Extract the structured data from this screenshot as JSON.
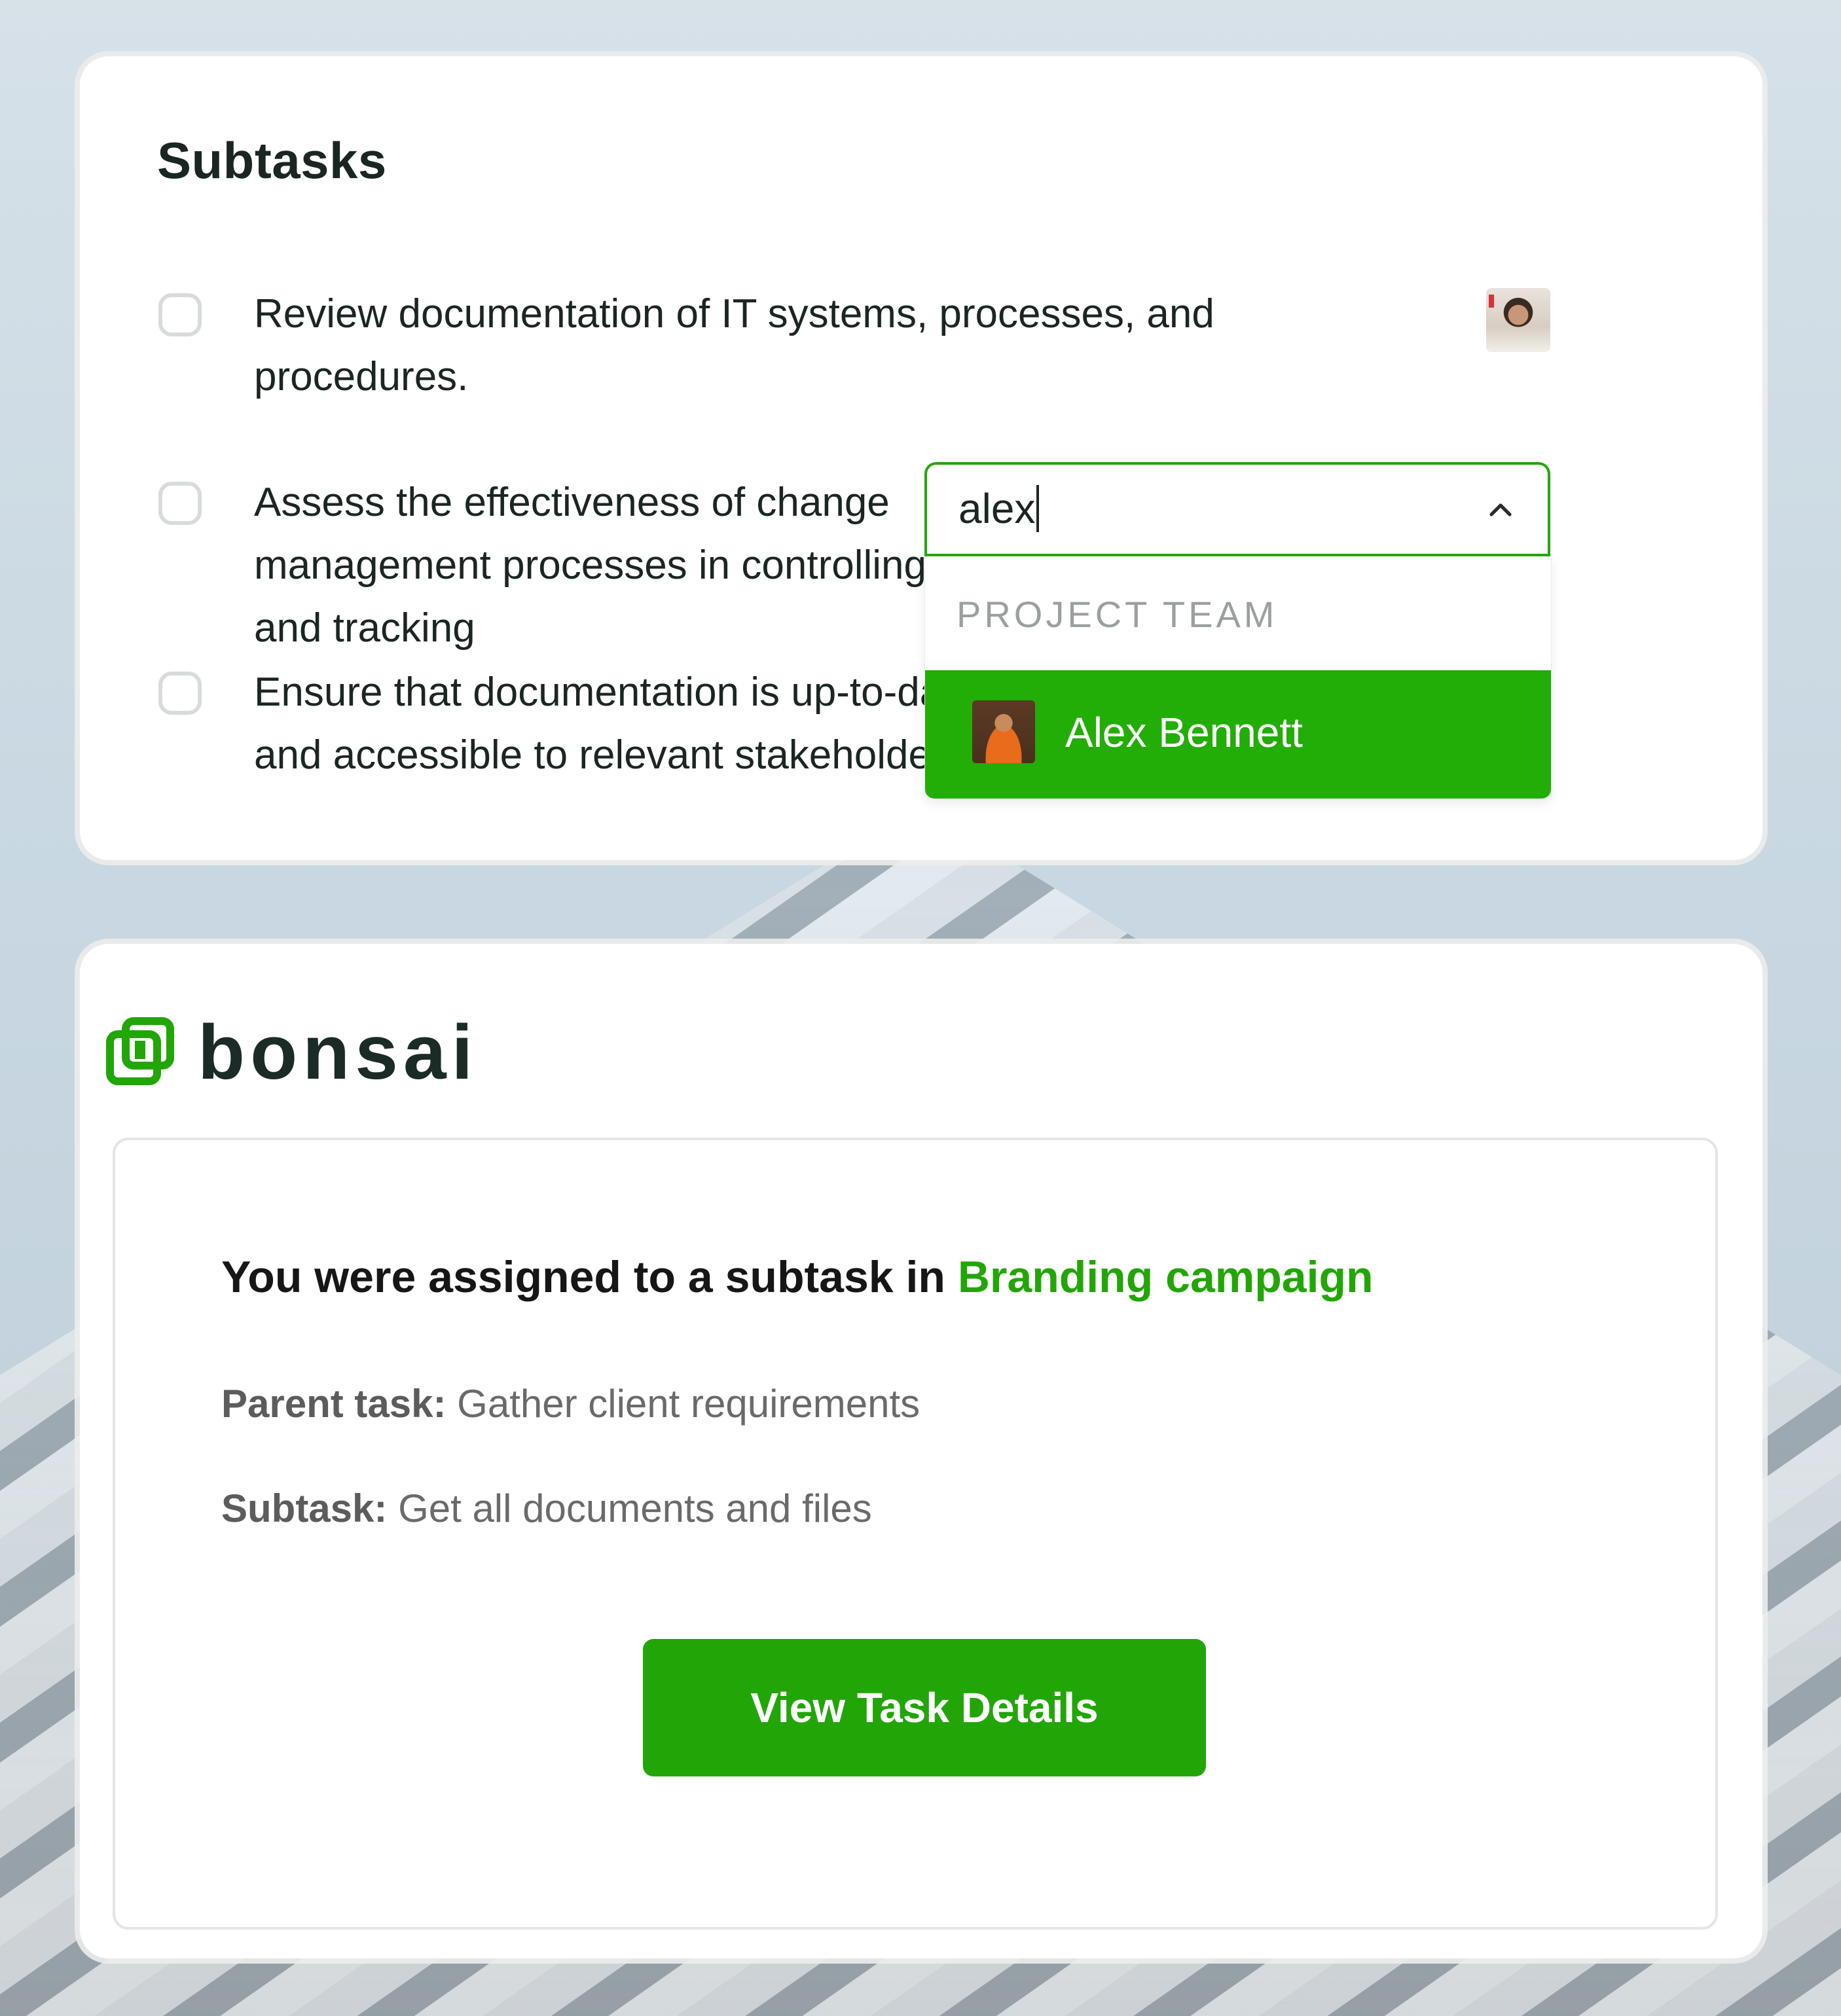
{
  "subtasks_panel": {
    "title": "Subtasks",
    "items": [
      {
        "text": "Review documentation of IT systems, processes, and procedures.",
        "checked": false,
        "has_assignee_avatar": true
      },
      {
        "text": "Assess the effectiveness of change management processes in controlling and tracking",
        "checked": false
      },
      {
        "text": "Ensure that documentation is up-to-date and accessible to relevant stakeholders.",
        "checked": false
      }
    ]
  },
  "assignee_dropdown": {
    "query": "alex",
    "group_label": "PROJECT TEAM",
    "options": [
      {
        "name": "Alex Bennett",
        "highlighted": true
      }
    ],
    "chevron_icon": "chevron-up-icon"
  },
  "email": {
    "brand": "bonsai",
    "headline_prefix": "You were assigned to a subtask in ",
    "project_link": "Branding campaign",
    "parent_task_label": "Parent task:",
    "parent_task_value": "Gather client requirements",
    "subtask_label": "Subtask:",
    "subtask_value": "Get all documents and files",
    "button_label": "View Task Details"
  },
  "colors": {
    "accent_green": "#22a607",
    "text_dark": "#1b2622",
    "muted_text": "#6a6a6a"
  }
}
